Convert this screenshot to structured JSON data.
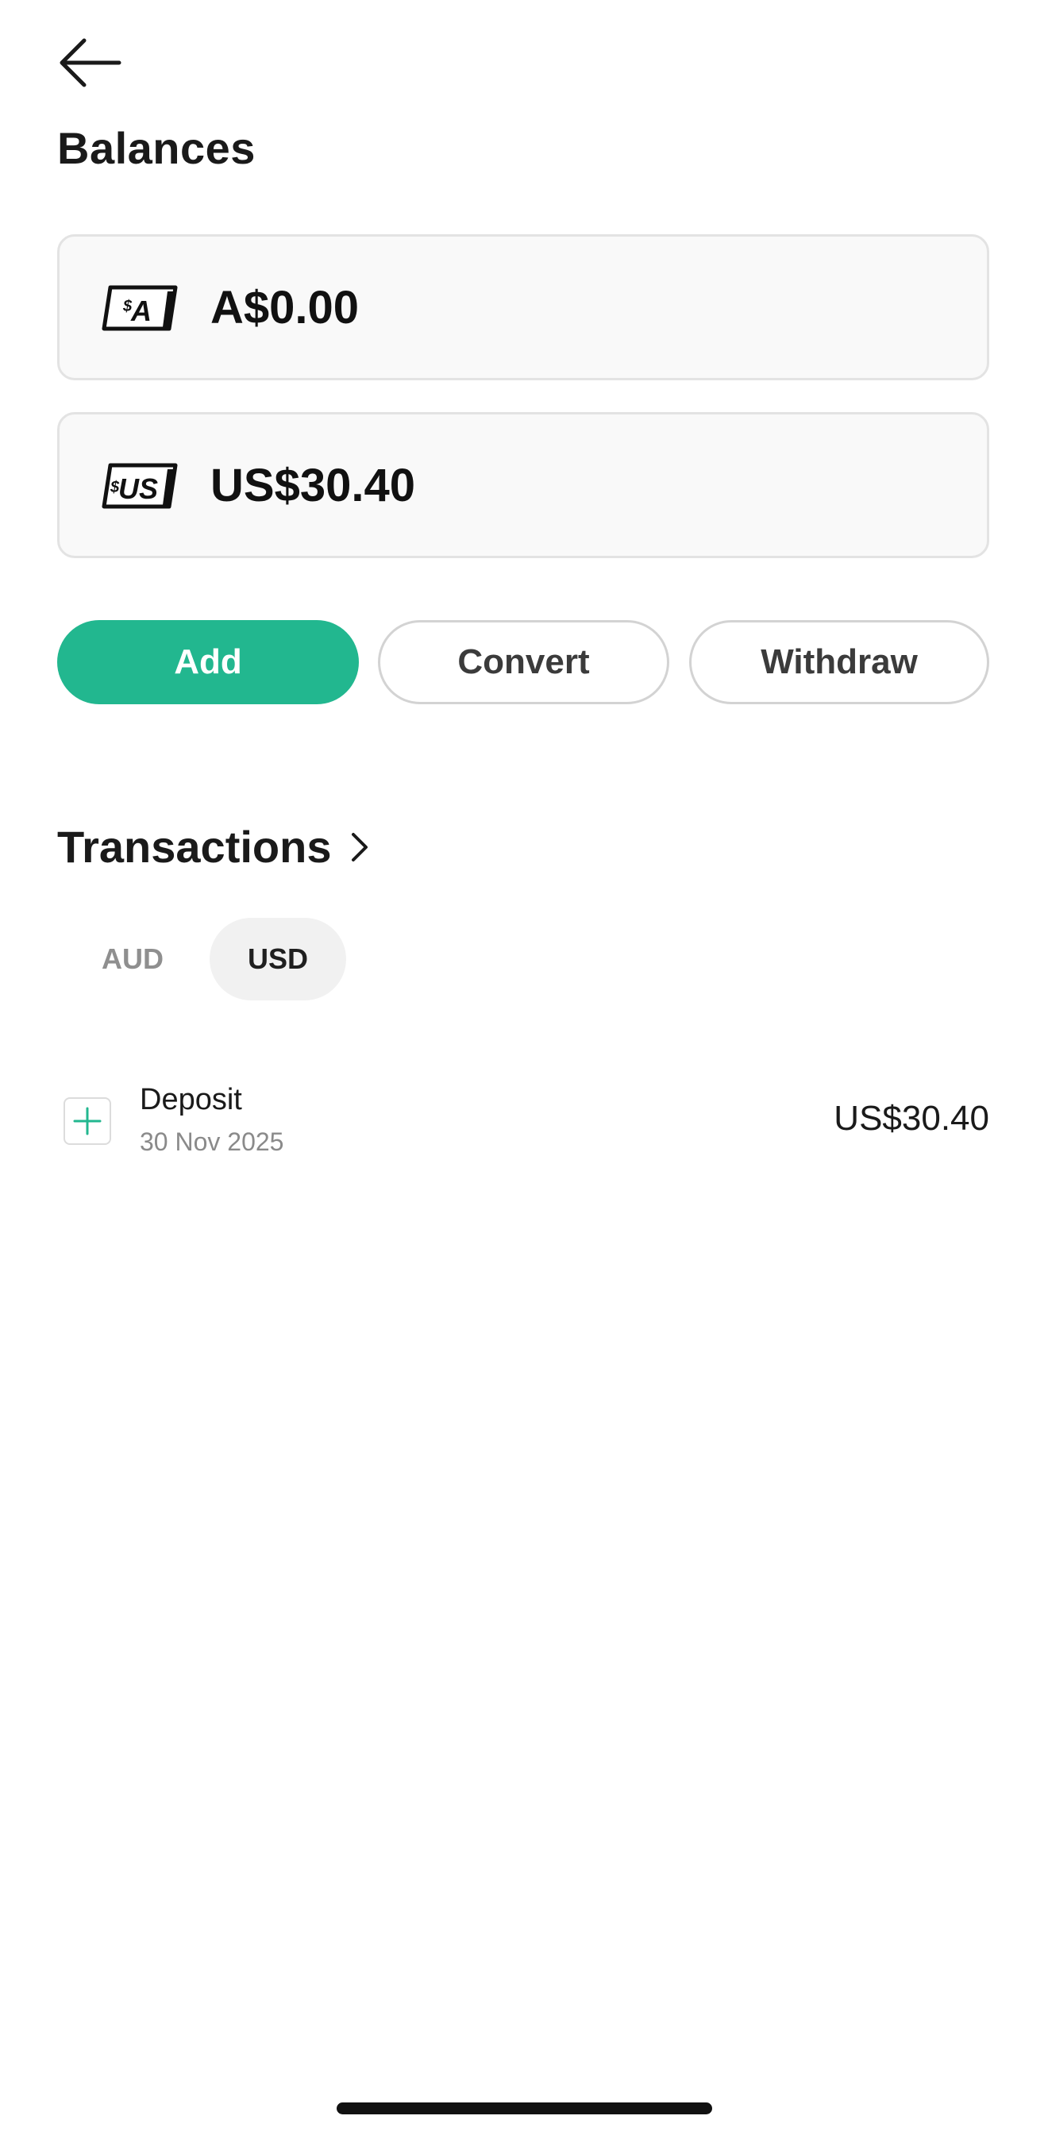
{
  "header": {
    "title": "Balances",
    "back_icon": "arrow-left-icon"
  },
  "balances": [
    {
      "currency_icon": "aud-cash-icon",
      "icon_text_small": "$",
      "icon_text_big": "A",
      "amount": "A$0.00"
    },
    {
      "currency_icon": "usd-cash-icon",
      "icon_text_small": "$",
      "icon_text_big": "US",
      "amount": "US$30.40"
    }
  ],
  "actions": {
    "add": "Add",
    "convert": "Convert",
    "withdraw": "Withdraw"
  },
  "transactions": {
    "title": "Transactions",
    "chevron_icon": "chevron-right-icon",
    "tabs": [
      {
        "label": "AUD",
        "selected": false
      },
      {
        "label": "USD",
        "selected": true
      }
    ],
    "items": [
      {
        "icon": "plus-icon",
        "label": "Deposit",
        "date": "30 Nov 2025",
        "amount": "US$30.40"
      }
    ]
  },
  "colors": {
    "accent": "#22b78f",
    "card_bg": "#f9f9f9",
    "card_border": "#e3e3e3"
  }
}
